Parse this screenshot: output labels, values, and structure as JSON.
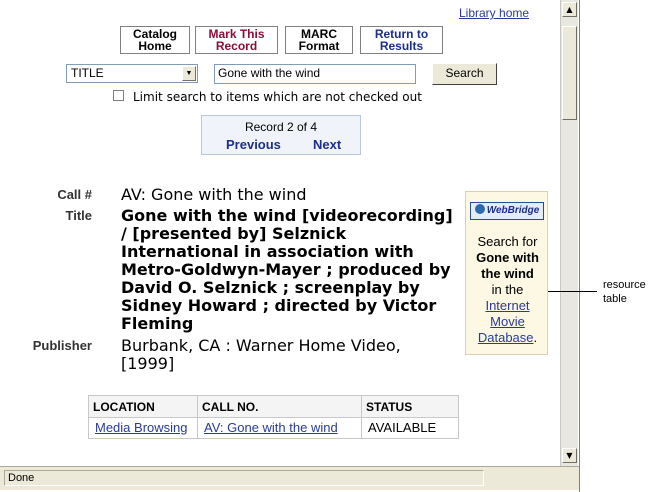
{
  "header": {
    "library_home": "Library home"
  },
  "nav_buttons": {
    "catalog_home": "Catalog Home",
    "mark_record": "Mark This Record",
    "marc_format": "MARC Format",
    "return_results": "Return to Results"
  },
  "search": {
    "field_selected": "TITLE",
    "query": "Gone with the wind",
    "button": "Search",
    "limit_label": "Limit search to items which are not checked out",
    "limit_checked": false
  },
  "record_nav": {
    "count": "Record 2 of 4",
    "previous": "Previous",
    "next": "Next"
  },
  "record": {
    "call_label": "Call #",
    "call_value": "AV: Gone with the wind",
    "title_label": "Title",
    "title_value": "Gone with the wind [videorecording] / [presented by] Selznick International in association with Metro-Goldwyn-Mayer ; produced by David O. Selznick ; screenplay by Sidney Howard ; directed by Victor Fleming",
    "publisher_label": "Publisher",
    "publisher_value": "Burbank, CA : Warner Home Video, [1999]"
  },
  "webbridge": {
    "logo": "WebBridge",
    "search_for": "Search for",
    "query": "Gone with the wind",
    "in_the": "in the",
    "database": "Internet Movie Database",
    "period": "."
  },
  "callout": "resource table",
  "holdings": {
    "headers": [
      "LOCATION",
      "CALL NO.",
      "STATUS"
    ],
    "rows": [
      {
        "location": "Media Browsing",
        "call_no": "AV: Gone with the wind",
        "status": "AVAILABLE"
      }
    ]
  },
  "statusbar": {
    "text": "Done"
  },
  "colors": {
    "link": "#2a3a9a",
    "mark_record": "#8a0d3a",
    "return_results": "#1c2f8a",
    "webbridge_bg": "#fdf8e3"
  }
}
